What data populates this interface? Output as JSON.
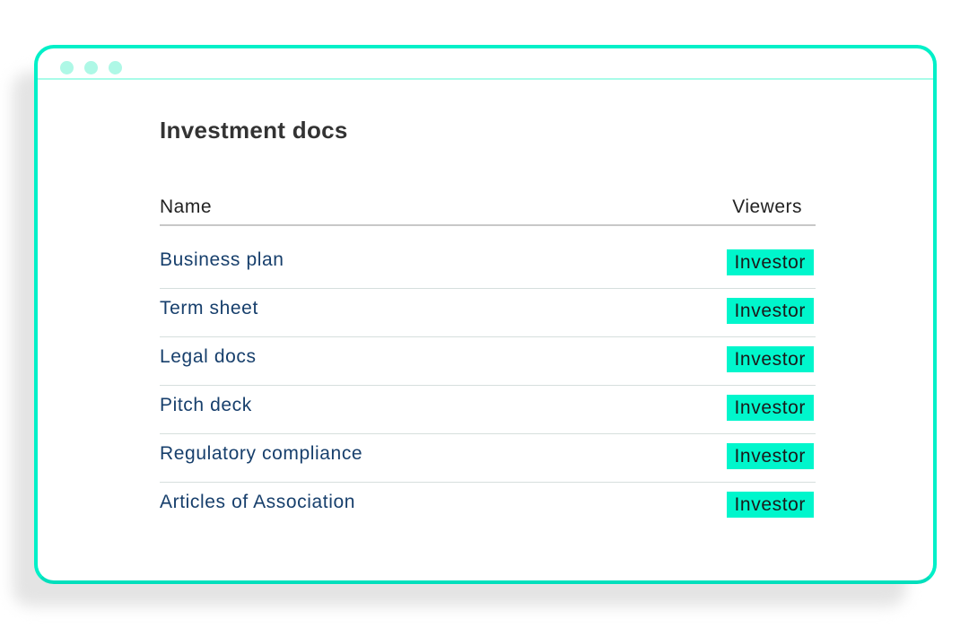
{
  "window": {
    "dots": [
      "window-dot",
      "window-dot",
      "window-dot"
    ]
  },
  "page": {
    "title": "Investment docs"
  },
  "table": {
    "columns": {
      "name": "Name",
      "viewers": "Viewers"
    },
    "rows": [
      {
        "name": "Business plan",
        "viewer": "Investor"
      },
      {
        "name": "Term sheet",
        "viewer": "Investor"
      },
      {
        "name": "Legal docs",
        "viewer": "Investor"
      },
      {
        "name": "Pitch deck",
        "viewer": "Investor"
      },
      {
        "name": "Regulatory compliance",
        "viewer": "Investor"
      },
      {
        "name": "Articles of Association",
        "viewer": "Investor"
      }
    ]
  },
  "colors": {
    "accent": "#00f0c8",
    "badge": "#00f6cc",
    "link": "#173f6c",
    "title": "#333333"
  }
}
